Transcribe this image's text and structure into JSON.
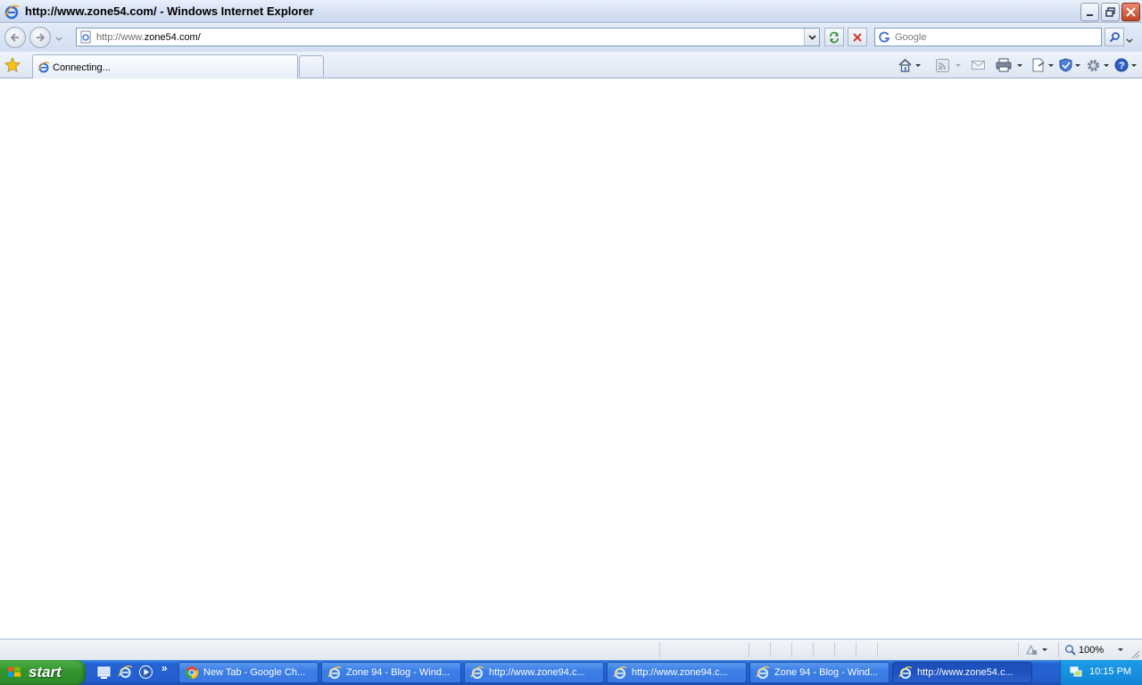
{
  "window": {
    "title": "http://www.zone54.com/ - Windows Internet Explorer"
  },
  "address_bar": {
    "url_prefix": "http://www.",
    "url_domain": "zone54.com/",
    "search_placeholder": "Google"
  },
  "tabs": [
    {
      "label": "Connecting..."
    }
  ],
  "status_bar": {
    "zoom": "100%"
  },
  "taskbar": {
    "start_label": "start",
    "more_label": "»",
    "buttons": [
      {
        "label": "New Tab - Google Ch...",
        "icon": "chrome-icon",
        "active": false
      },
      {
        "label": "Zone 94 - Blog - Wind...",
        "icon": "ie-icon",
        "active": false
      },
      {
        "label": "http://www.zone94.c...",
        "icon": "ie-icon",
        "active": false
      },
      {
        "label": "http://www.zone94.c...",
        "icon": "ie-icon",
        "active": false
      },
      {
        "label": "Zone 94 - Blog - Wind...",
        "icon": "ie-icon",
        "active": false
      },
      {
        "label": "http://www.zone54.c...",
        "icon": "ie-icon",
        "active": true
      }
    ],
    "clock": "10:15 PM"
  },
  "colors": {
    "taskbar": "#245edb",
    "start": "#3c9a35",
    "tray": "#1690e0",
    "ie_blue": "#2a6bd6"
  }
}
